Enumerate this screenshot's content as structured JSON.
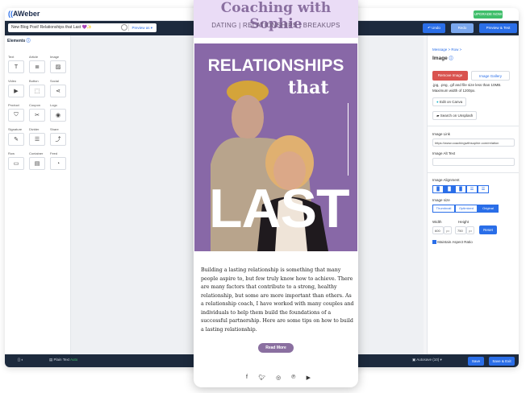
{
  "app": {
    "logo": "AWeber",
    "upgrade_label": "UPGRADE NOW"
  },
  "toolbar": {
    "subject": "New Blog Post! Relationships that Last 💜✨",
    "preview_chip": "Preview as ▾",
    "undo_label": "↶ Undo",
    "redo_label": "Redo",
    "preview_label": "Preview & Test"
  },
  "elements_panel": {
    "title": "Elements",
    "items": [
      {
        "label": "Text",
        "icon": "T"
      },
      {
        "label": "Article",
        "icon": "≣"
      },
      {
        "label": "Image",
        "icon": "▨"
      },
      {
        "label": "Video",
        "icon": "▶"
      },
      {
        "label": "Button",
        "icon": "⬚"
      },
      {
        "label": "Social",
        "icon": "⋖"
      },
      {
        "label": "Product",
        "icon": "⛉"
      },
      {
        "label": "Coupon",
        "icon": "✂"
      },
      {
        "label": "Logo",
        "icon": "◉"
      },
      {
        "label": "Signature",
        "icon": "✎"
      },
      {
        "label": "Divider",
        "icon": "☰"
      },
      {
        "label": "Share",
        "icon": "⤴"
      },
      {
        "label": "Row",
        "icon": "▭"
      },
      {
        "label": "Container",
        "icon": "▤"
      },
      {
        "label": "Feed",
        "icon": "◔"
      }
    ]
  },
  "email": {
    "title": "Coaching with Sophie",
    "subtitle": "DATING | RELATIONSHIPS | BREAKUPS",
    "hero_line1": "RELATIONSHIPS",
    "hero_line2": "that",
    "hero_line3": "LAST",
    "body": "Building a lasting relationship is something that many people aspire to, but few truly know how to achieve. There are many factors that contribute to a strong, healthy relationship, but some are more important than others. As a relationship coach, I have worked with many couples and individuals to help them build the foundations of a successful partnership. Here are some tips on how to build a lasting relationship.",
    "read_more": "Read More",
    "social_icons": [
      "facebook-icon",
      "twitter-icon",
      "instagram-icon",
      "pinterest-icon",
      "youtube-icon"
    ]
  },
  "right_panel": {
    "breadcrumb": "Message > Row >",
    "title": "Image",
    "remove_image": "Remove Image",
    "image_gallery": "Image Gallery",
    "hint1": ".jpg, .png, .gif and file size less than 10MB.",
    "hint2": "Maximum width of 1200px.",
    "edit_canva": "Edit on Canva",
    "search_unsplash": "Search on Unsplash",
    "image_link_label": "Image Link",
    "image_link_value": "https://www.coachingwithsophie.com/relation",
    "alt_label": "Image Alt Text",
    "alignment_label": "Image Alignment",
    "size_label": "Image size",
    "size_options": [
      "Thumbnail",
      "Optimized",
      "Original"
    ],
    "width_label": "Width",
    "height_label": "Height",
    "width_value": "600",
    "height_value": "750",
    "px": "px",
    "reset": "Reset",
    "maintain_ratio": "Maintain Aspect Ratio"
  },
  "bottom_bar": {
    "plain_text": "Plain Text",
    "plain_text_mode": "Auto",
    "autosave": "Autosave (10) ▾",
    "save": "Save",
    "save_exit": "Save & Exit"
  },
  "colors": {
    "accent": "#2a6ee8",
    "brand_purple": "#8a6fa0",
    "dark": "#1d2a3d",
    "danger": "#d9534f"
  }
}
